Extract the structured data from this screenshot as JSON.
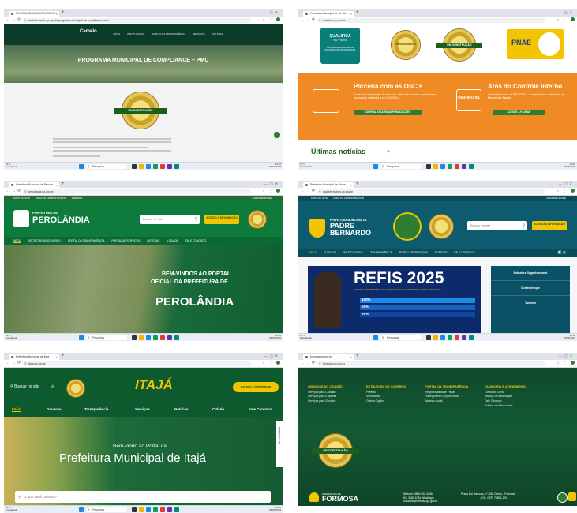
{
  "tiles": [
    {
      "tab_title": "PROGRAMA MUNICIPAL DE CO",
      "url": "aeiadecamelo.go.gov.br/programa-municipal-de-compliance-pmc/",
      "site": {
        "logo": "Camelo",
        "menu": [
          "INÍCIO",
          "INSTITUCIONAL",
          "PORTAL DA TRANSPARÊNCIA",
          "SERVIÇOS",
          "NOTÍCIAS"
        ],
        "page_title": "PROGRAMA MUNICIPAL DE COMPLIANCE – PMC",
        "seal_text": "EM CONSTRUÇÃO"
      }
    },
    {
      "tab_title": "Prefeitura Municipal de Go Go",
      "url": "mineiros.go.gov.br",
      "site": {
        "badge1_title": "QUALIFICA",
        "badge1_sub": "VAI VIEIRA",
        "badge1_caption": "PROGRAMA MUNICIPAL DE QUALIFICAÇÃO PROFISSIONAL",
        "badge2_text": "TRANSPARÊNCIA",
        "seal_text": "EM CONSTRUÇÃO",
        "badge4_text": "PNAE",
        "card1_title": "Parceria com as OSC's",
        "card1_text": "Portal das Organizações Sociais Civis. Aqui você encontra as publicações necessárias referentes à Lei 13019/2014.",
        "card1_button": "CONFIRA AS ÚLTIMAS PUBLICAÇÕES",
        "card2_title": "Atos do Controle Interno",
        "card2_logo": "TIME BRASIL",
        "card2_text": "Informações sobre o TIME BRASIL - Transparência e Integridade em Municípios e Estados",
        "card2_button": "ACESSE A PÁGINA",
        "news_title": "Últimas notícias"
      }
    },
    {
      "tab_title": "Prefeitura Municipal de Perolân",
      "url": "perolandia.go.gov.br",
      "site": {
        "top_links": [
          "MAPA DO SITE",
          "ÁREA DO ADMINISTRADOR",
          "WEBMAIL"
        ],
        "accessibility": "ACESSIBILIDADE",
        "logo_top": "PREFEITURA DE",
        "logo_name": "PEROLÂNDIA",
        "search_placeholder": "Buscar no site",
        "access_button": "ACESSO À INFORMAÇÃO",
        "menu": [
          "INÍCIO",
          "SECRETARIAS GOVERNO",
          "PORTAL DA TRANSPARÊNCIA",
          "PORTAL DE SERVIÇOS",
          "NOTÍCIAS",
          "A CIDADE",
          "FALE CONOSCO"
        ],
        "hero_line1": "BEM-VINDOS AO PORTAL",
        "hero_line2": "OFICIAL DA PREFEITURA DE",
        "hero_line3": "PEROLÂNDIA"
      }
    },
    {
      "tab_title": "Prefeitura Municipal de Padre",
      "url": "padrebernardo.go.gov.br",
      "site": {
        "top_links": [
          "MAPA DO SITE",
          "ÁREA DO ADMINISTRADOR"
        ],
        "accessibility": "ACESSIBILIDADE",
        "logo_top": "PREFEITURA MUNICIPAL DE",
        "logo_name_1": "PADRE",
        "logo_name_2": "BERNARDO",
        "search_placeholder": "Buscar no site",
        "access_button": "ACESSO À INFORMAÇÃO",
        "menu": [
          "INÍCIO",
          "A CIDADE",
          "INSTITUCIONAL",
          "TRANSPARÊNCIA",
          "PORTAL DE SERVIÇOS",
          "NOTÍCIAS",
          "FALE CONOSCO"
        ],
        "banner_title": "REFIS 2025",
        "banner_sub": "CHEGOU A OPORTUNIDADE DE FICAR EM DIA COM O MUNICÍPIO E AINDA ECONOMIZAR",
        "discounts": [
          "100%",
          "60%",
          "30%"
        ],
        "side_links": [
          "Estrutura Organizacional",
          "Contracheque",
          "Turismo"
        ]
      }
    },
    {
      "tab_title": "Prefeitura Municipal de Itajá",
      "url": "itaja.go.gov.br",
      "site": {
        "search_label": "Buscar no site",
        "logo_name": "ITAJÁ",
        "access_button": "Acesso à Informação",
        "menu": [
          "Início",
          "Governo",
          "Transparência",
          "Serviços",
          "Notícias",
          "Cidade",
          "Fale Conosco"
        ],
        "hero_small": "Bem-vindo ao Portal da",
        "hero_big": "Prefeitura Municipal de Itajá",
        "search_placeholder": "O que você procura?",
        "side_label": "Acessibilidade"
      }
    },
    {
      "tab_title": "formosa.go.gov.br",
      "url": "formosa.go.gov.br",
      "site": {
        "columns": [
          {
            "heading": "SERVIÇOS AO CIDADÃO",
            "items": [
              "Serviços para Cidadão",
              "Serviços para Empresa",
              "Serviços para Servidor"
            ]
          },
          {
            "heading": "ESTRUTURA DE GOVERNO",
            "items": [
              "Prefeito",
              "Secretarias",
              "Outros Órgãos"
            ]
          },
          {
            "heading": "PORTAL DA TRANSPARÊNCIA",
            "items": [
              "Responsabilidade Fiscal",
              "Planejamento Orçamentário",
              "Balanço Anual"
            ]
          },
          {
            "heading": "OUVIDORIA E ATENDIMENTO",
            "items": [
              "Ouvidoria Geral",
              "Serviço de Informação",
              "Fale Conosco",
              "Política de Privacidade"
            ]
          }
        ],
        "seal_text": "EM CONSTRUÇÃO",
        "logo_top": "PREFEITURA DE",
        "logo_name": "FORMOSA",
        "phone_1": "Telefone: 0800-000-4488",
        "phone_2": "(61) 3981-1034 WhatsApp",
        "email": "ouvidoria@formosa.go.gov.br",
        "address_1": "Praça Rui Barbosa, nº 208, Centro - Formosa",
        "address_2": "- GO. CEP: 73801-220"
      }
    }
  ],
  "taskbar": {
    "weather_temp": "21°C",
    "weather_desc": "Ensolarado",
    "search": "Pesquisar",
    "time": "13:52",
    "date": "26/06/2025"
  },
  "colors": {
    "green_dark": "#0d3b2a",
    "orange": "#f08a24",
    "teal": "#0d5b6e",
    "gold": "#c9a227"
  }
}
